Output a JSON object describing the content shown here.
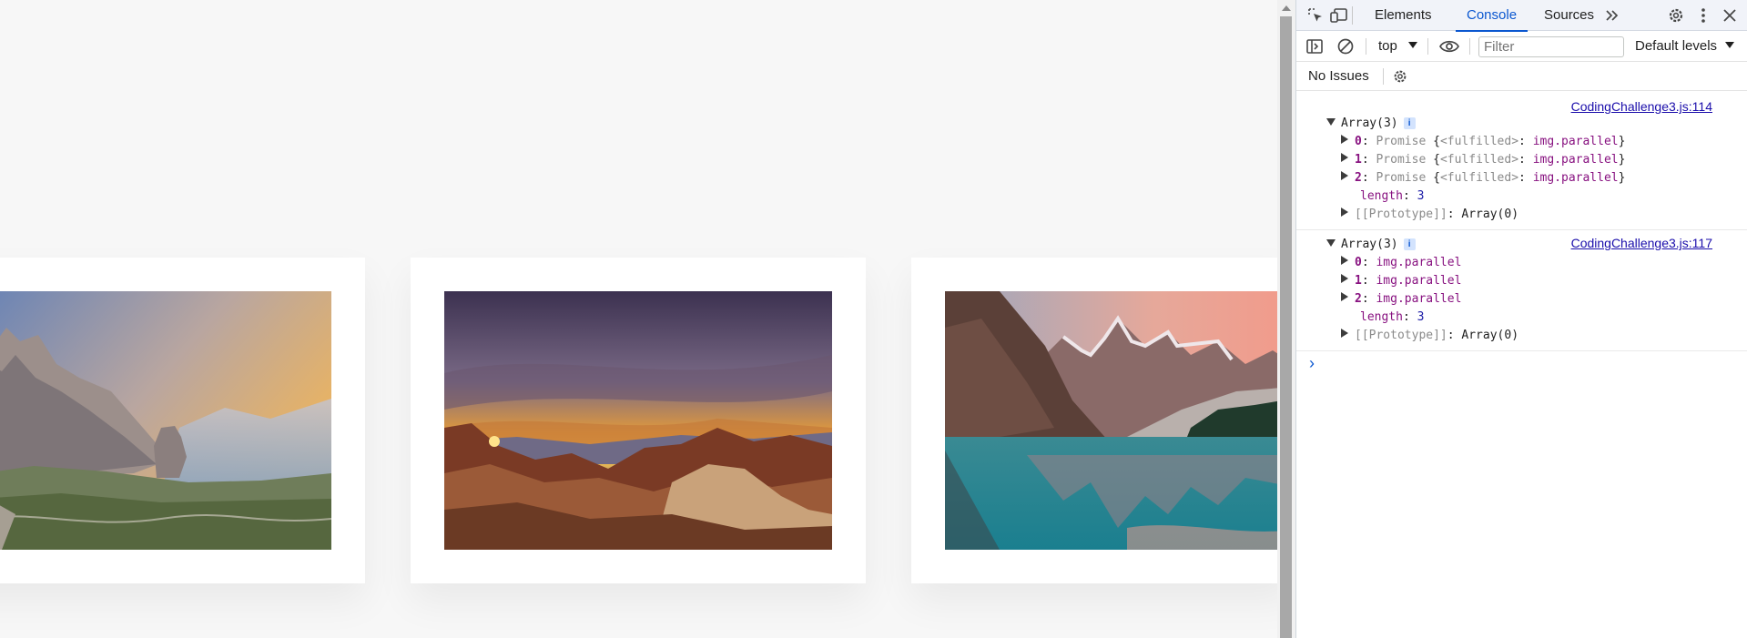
{
  "page": {
    "cards": [
      {
        "name": "dolomites-mountain-photo"
      },
      {
        "name": "desert-sunset-photo"
      },
      {
        "name": "moraine-lake-photo"
      }
    ]
  },
  "devtools": {
    "tabs": [
      "Elements",
      "Console",
      "Sources"
    ],
    "active_tab": "Console",
    "toolbar": {
      "context": "top",
      "filter_placeholder": "Filter",
      "levels": "Default levels"
    },
    "issues_text": "No Issues",
    "messages": [
      {
        "source": "CodingChallenge3.js:114",
        "header": "Array(3)",
        "badge": "i",
        "items": [
          {
            "key": "0",
            "promise": "Promise",
            "state_key": "<fulfilled>",
            "value": "img.parallel"
          },
          {
            "key": "1",
            "promise": "Promise",
            "state_key": "<fulfilled>",
            "value": "img.parallel"
          },
          {
            "key": "2",
            "promise": "Promise",
            "state_key": "<fulfilled>",
            "value": "img.parallel"
          }
        ],
        "length_key": "length",
        "length_value": "3",
        "proto_key": "[[Prototype]]",
        "proto_value": "Array(0)"
      },
      {
        "source": "CodingChallenge3.js:117",
        "header": "Array(3)",
        "badge": "i",
        "items": [
          {
            "key": "0",
            "value": "img.parallel"
          },
          {
            "key": "1",
            "value": "img.parallel"
          },
          {
            "key": "2",
            "value": "img.parallel"
          }
        ],
        "length_key": "length",
        "length_value": "3",
        "proto_key": "[[Prototype]]",
        "proto_value": "Array(0)"
      }
    ],
    "prompt_symbol": "›",
    "colors": {
      "accent": "#0b57d0",
      "key": "#881280",
      "number": "#1a1aa6",
      "link": "#1a0dab"
    }
  }
}
